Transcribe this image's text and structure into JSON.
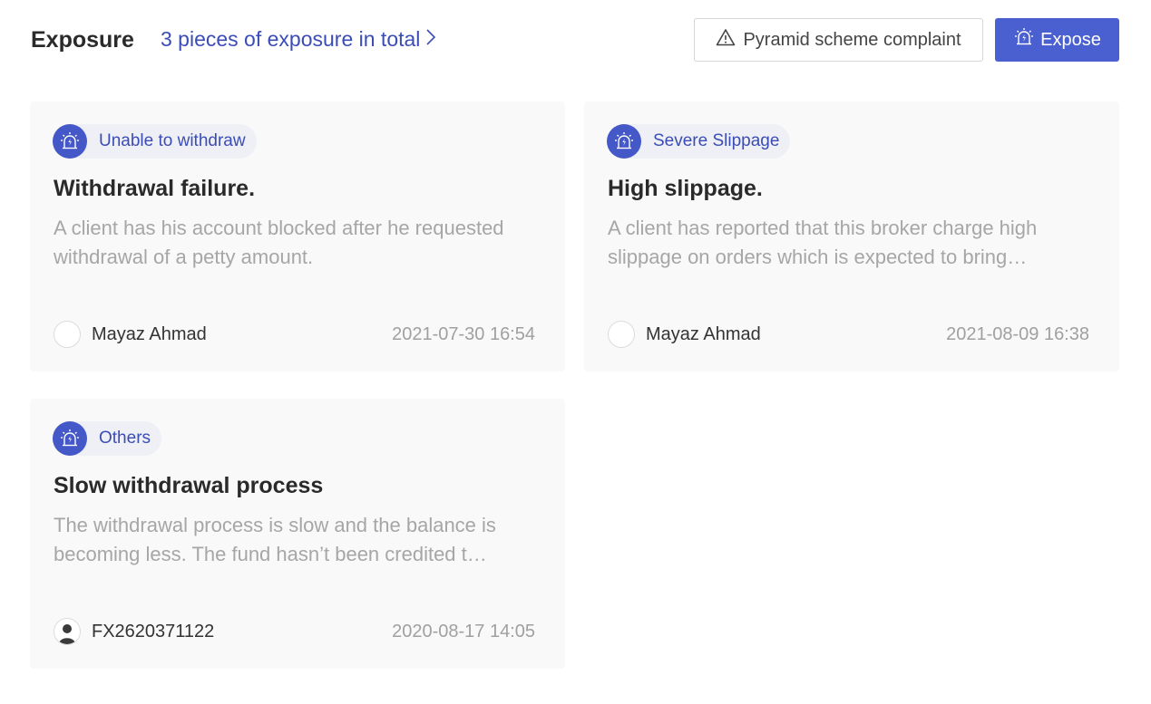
{
  "header": {
    "title": "Exposure",
    "total_link": "3 pieces of exposure in total",
    "complaint_button": "Pyramid scheme complaint",
    "expose_button": "Expose"
  },
  "colors": {
    "accent": "#4a5fd0",
    "link": "#3b4db5",
    "card_bg": "#f9f9fa"
  },
  "cards": [
    {
      "tag": "Unable to withdraw",
      "tag_icon": "alarm-siren-icon",
      "title": "Withdrawal failure.",
      "description": "A client has his account blocked after he requested withdrawal of a petty amount.",
      "author": "Mayaz Ahmad",
      "avatar": "blank",
      "date": "2021-07-30 16:54"
    },
    {
      "tag": "Severe Slippage",
      "tag_icon": "alarm-siren-icon",
      "title": "High slippage.",
      "description": "A client has reported that this broker charge high slippage on orders which is expected to bring…",
      "author": "Mayaz Ahmad",
      "avatar": "blank",
      "date": "2021-08-09 16:38"
    },
    {
      "tag": "Others",
      "tag_icon": "alarm-siren-icon",
      "title": "Slow withdrawal process",
      "description": "The withdrawal process is slow and the balance is becoming less. The fund hasn’t been credited t…",
      "author": "FX2620371122",
      "avatar": "user-silhouette",
      "date": "2020-08-17 14:05"
    }
  ]
}
